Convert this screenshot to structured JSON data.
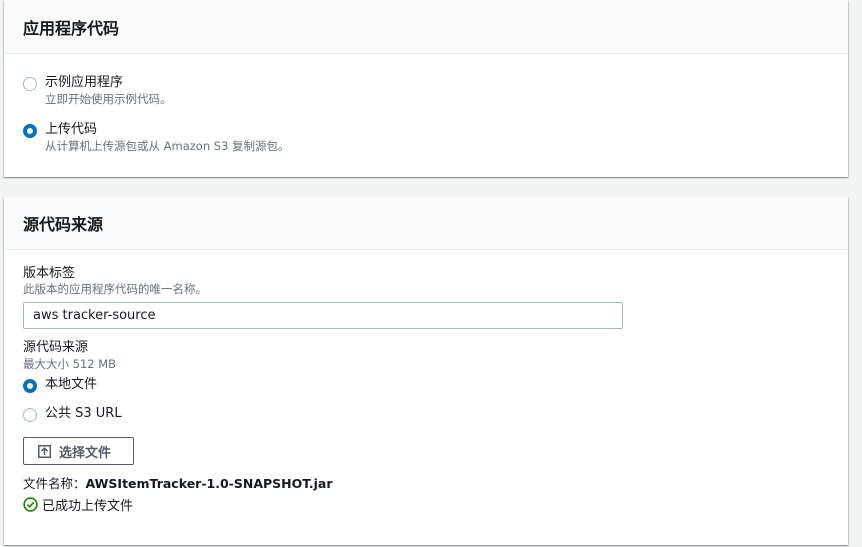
{
  "app_code": {
    "title": "应用程序代码",
    "options": [
      {
        "label": "示例应用程序",
        "description": "立即开始使用示例代码。",
        "selected": false
      },
      {
        "label": "上传代码",
        "description": "从计算机上传源包或从 Amazon S3 复制源包。",
        "selected": true
      }
    ]
  },
  "source": {
    "title": "源代码来源",
    "version_label": {
      "label": "版本标签",
      "description": "此版本的应用程序代码的唯一名称。",
      "value": "aws tracker-source"
    },
    "origin": {
      "label": "源代码来源",
      "description": "最大大小 512 MB",
      "options": [
        {
          "label": "本地文件",
          "selected": true
        },
        {
          "label": "公共 S3 URL",
          "selected": false
        }
      ]
    },
    "upload_button_label": "选择文件",
    "file_name_prefix": "文件名称：",
    "file_name": "AWSItemTracker-1.0-SNAPSHOT.jar",
    "success_text": "已成功上传文件"
  },
  "colors": {
    "accent": "#0073bb",
    "success": "#1d8102",
    "muted_text": "#687078"
  },
  "icons": [
    "upload-icon",
    "status-success-icon"
  ]
}
